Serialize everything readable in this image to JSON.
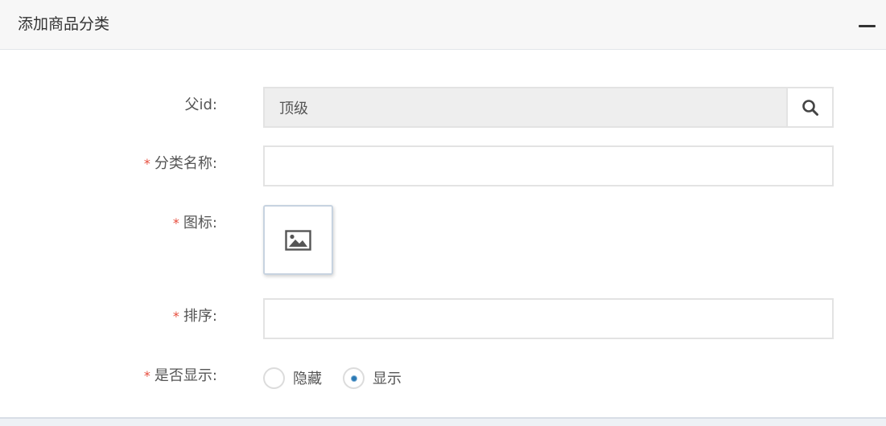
{
  "panel": {
    "title": "添加商品分类"
  },
  "form": {
    "parent_id": {
      "label": "父id:",
      "value": "顶级",
      "required": false
    },
    "category_name": {
      "label": "分类名称:",
      "value": "",
      "required": true
    },
    "icon": {
      "label": "图标:",
      "required": true
    },
    "sort": {
      "label": "排序:",
      "value": "",
      "required": true
    },
    "display": {
      "label": "是否显示:",
      "required": true,
      "options": [
        {
          "label": "隐藏",
          "checked": false
        },
        {
          "label": "显示",
          "checked": true
        }
      ]
    }
  },
  "required_mark": "*",
  "colors": {
    "required": "#e74c3c",
    "radio_checked": "#2b79b4",
    "readonly_bg": "#eeeeee"
  }
}
